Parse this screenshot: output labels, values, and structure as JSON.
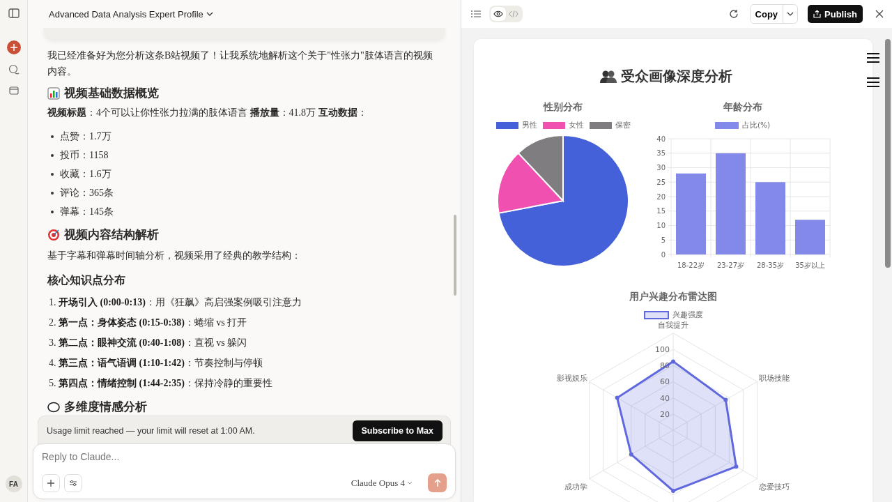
{
  "sidebar": {
    "avatar": "FA"
  },
  "chat": {
    "title": "Advanced Data Analysis Expert Profile",
    "blocks": [
      {
        "kind": "paragraph",
        "text": "我已经准备好为您分析这条B站视频了！让我系统地解析这个关于\"性张力\"肢体语言的视频内容。"
      },
      {
        "kind": "heading",
        "text": "视频基础数据概览"
      },
      {
        "kind": "meta",
        "text": "**视频标题**：4个可以让你性张力拉满的肢体语言 **播放量**：41.8万 **互动数据**："
      },
      {
        "kind": "bullet",
        "text": "点赞：1.7万"
      },
      {
        "kind": "bullet",
        "text": "投币：1158"
      },
      {
        "kind": "bullet",
        "text": "收藏：1.6万"
      },
      {
        "kind": "bullet",
        "text": "评论：365条"
      },
      {
        "kind": "bullet",
        "text": "弹幕：145条"
      },
      {
        "kind": "heading",
        "text": "视频内容结构解析"
      },
      {
        "kind": "paragraph",
        "text": "基于字幕和弹幕时间轴分析，视频采用了经典的教学结构："
      },
      {
        "kind": "subheading",
        "text": "核心知识点分布"
      },
      {
        "kind": "numbered",
        "text": "1. **开场引入 (0:00-0:13)**：用《狂飙》高启强案例吸引注意力"
      },
      {
        "kind": "numbered",
        "text": "2. **第一点：身体姿态 (0:15-0:38)**：蜷缩 vs 打开"
      },
      {
        "kind": "numbered",
        "text": "3. **第二点：眼神交流 (0:40-1:08)**：直视 vs 躲闪"
      },
      {
        "kind": "numbered",
        "text": "4. **第三点：语气语调 (1:10-1:42)**：节奏控制与停顿"
      },
      {
        "kind": "numbered",
        "text": "5. **第四点：情绪控制 (1:44-2:35)**：保持冷静的重要性"
      },
      {
        "kind": "heading",
        "text": "多维度情感分析"
      }
    ],
    "banner": {
      "text": "Usage limit reached — your limit will reset at 1:00 AM.",
      "button": "Subscribe to Max"
    },
    "composer": {
      "placeholder": "Reply to Claude...",
      "model": "Claude Opus 4"
    }
  },
  "artifact": {
    "toolbar": {
      "view_tabs": [
        {
          "kind": "preview",
          "selected": true
        },
        {
          "kind": "code",
          "selected": false
        }
      ],
      "copy": "Copy",
      "publish": "Publish"
    },
    "title": "受众画像深度分析",
    "pie": {
      "title": "性别分布",
      "legend": [
        {
          "label": "男性",
          "color": "#4561d9"
        },
        {
          "label": "女性",
          "color": "#f050b0"
        },
        {
          "label": "保密",
          "color": "#7f7d80"
        }
      ]
    },
    "bar": {
      "title": "年龄分布",
      "chart_data": {
        "type": "bar",
        "grid": true,
        "categories": [
          "18-22岁",
          "23-27岁",
          "28-35岁",
          "35岁以上"
        ],
        "series": [
          {
            "name": "占比(%)",
            "color": "#8289e8",
            "values": [
              28,
              35,
              25,
              12
            ]
          }
        ],
        "yticks": [
          0,
          5,
          10,
          15,
          20,
          25,
          30,
          35,
          40
        ],
        "ylim": [
          0,
          40
        ]
      }
    },
    "radar": {
      "title": "用户兴趣分布雷达图",
      "legend": "兴趣强度",
      "axes": [
        "自我提升",
        "职场技能",
        "恋爱技巧",
        "成功学",
        "影视娱乐"
      ],
      "ticks": [
        "100",
        "80",
        "60",
        "40",
        "20"
      ]
    }
  }
}
